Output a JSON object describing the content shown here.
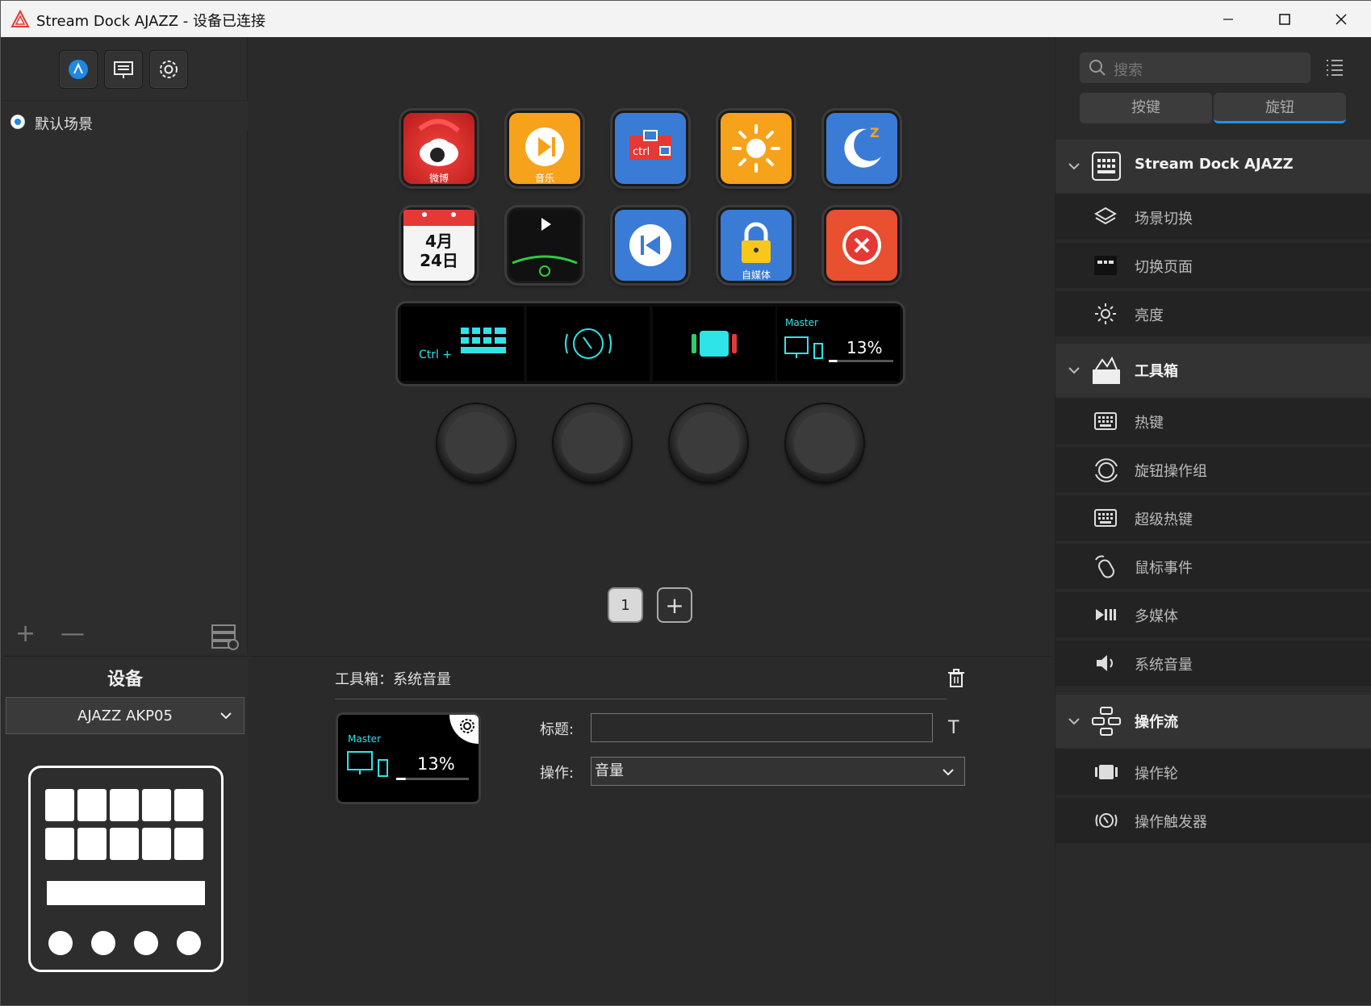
{
  "window": {
    "title": "Stream Dock AJAZZ - 设备已连接"
  },
  "scenes": {
    "items": [
      {
        "label": "默认场景",
        "selected": true
      }
    ]
  },
  "device_panel": {
    "title": "设备",
    "selected_device": "AJAZZ AKP05"
  },
  "keys": [
    {
      "name": "weibo",
      "caption": "微博",
      "colors": [
        "#e53935",
        "#111"
      ]
    },
    {
      "name": "music",
      "caption": "音乐",
      "colors": [
        "#f7a21b"
      ]
    },
    {
      "name": "ctrl",
      "caption": "",
      "colors": [
        "#3a7bd5"
      ]
    },
    {
      "name": "brightness",
      "caption": "",
      "colors": [
        "#f7a21b"
      ]
    },
    {
      "name": "sleep",
      "caption": "",
      "colors": [
        "#3a7bd5"
      ]
    },
    {
      "name": "calendar",
      "caption": "",
      "date_text": "4月\n24日"
    },
    {
      "name": "timer",
      "caption": ""
    },
    {
      "name": "previous",
      "caption": ""
    },
    {
      "name": "lock",
      "caption": "自媒体"
    },
    {
      "name": "close",
      "caption": ""
    }
  ],
  "touch_strip": {
    "segments": [
      {
        "name": "hotkey",
        "label": "Ctrl +"
      },
      {
        "name": "trigger",
        "label": ""
      },
      {
        "name": "wheel",
        "label": ""
      },
      {
        "name": "volume",
        "label": "Master",
        "value_text": "13%",
        "level": 0.13
      }
    ]
  },
  "pages": {
    "current": "1",
    "add_label": "+"
  },
  "properties": {
    "heading": "工具箱：系统音量",
    "preview": {
      "label": "Master",
      "value_text": "13%",
      "level": 0.13
    },
    "title_label": "标题:",
    "title_value": "",
    "action_label": "操作:",
    "action_value": "音量"
  },
  "library": {
    "search_placeholder": "搜索",
    "tabs": {
      "keys": "按键",
      "knobs": "旋钮",
      "active": "knobs"
    },
    "categories": [
      {
        "label": "Stream Dock AJAZZ",
        "items": [
          "场景切换",
          "切换页面",
          "亮度"
        ]
      },
      {
        "label": "工具箱",
        "items": [
          "热键",
          "旋钮操作组",
          "超级热键",
          "鼠标事件",
          "多媒体",
          "系统音量"
        ]
      },
      {
        "label": "操作流",
        "items": [
          "操作轮",
          "操作触发器"
        ]
      }
    ]
  },
  "colors": {
    "accent": "#1e88e5",
    "background": "#2a2a2a",
    "strip_cyan": "#2fe4e8"
  }
}
